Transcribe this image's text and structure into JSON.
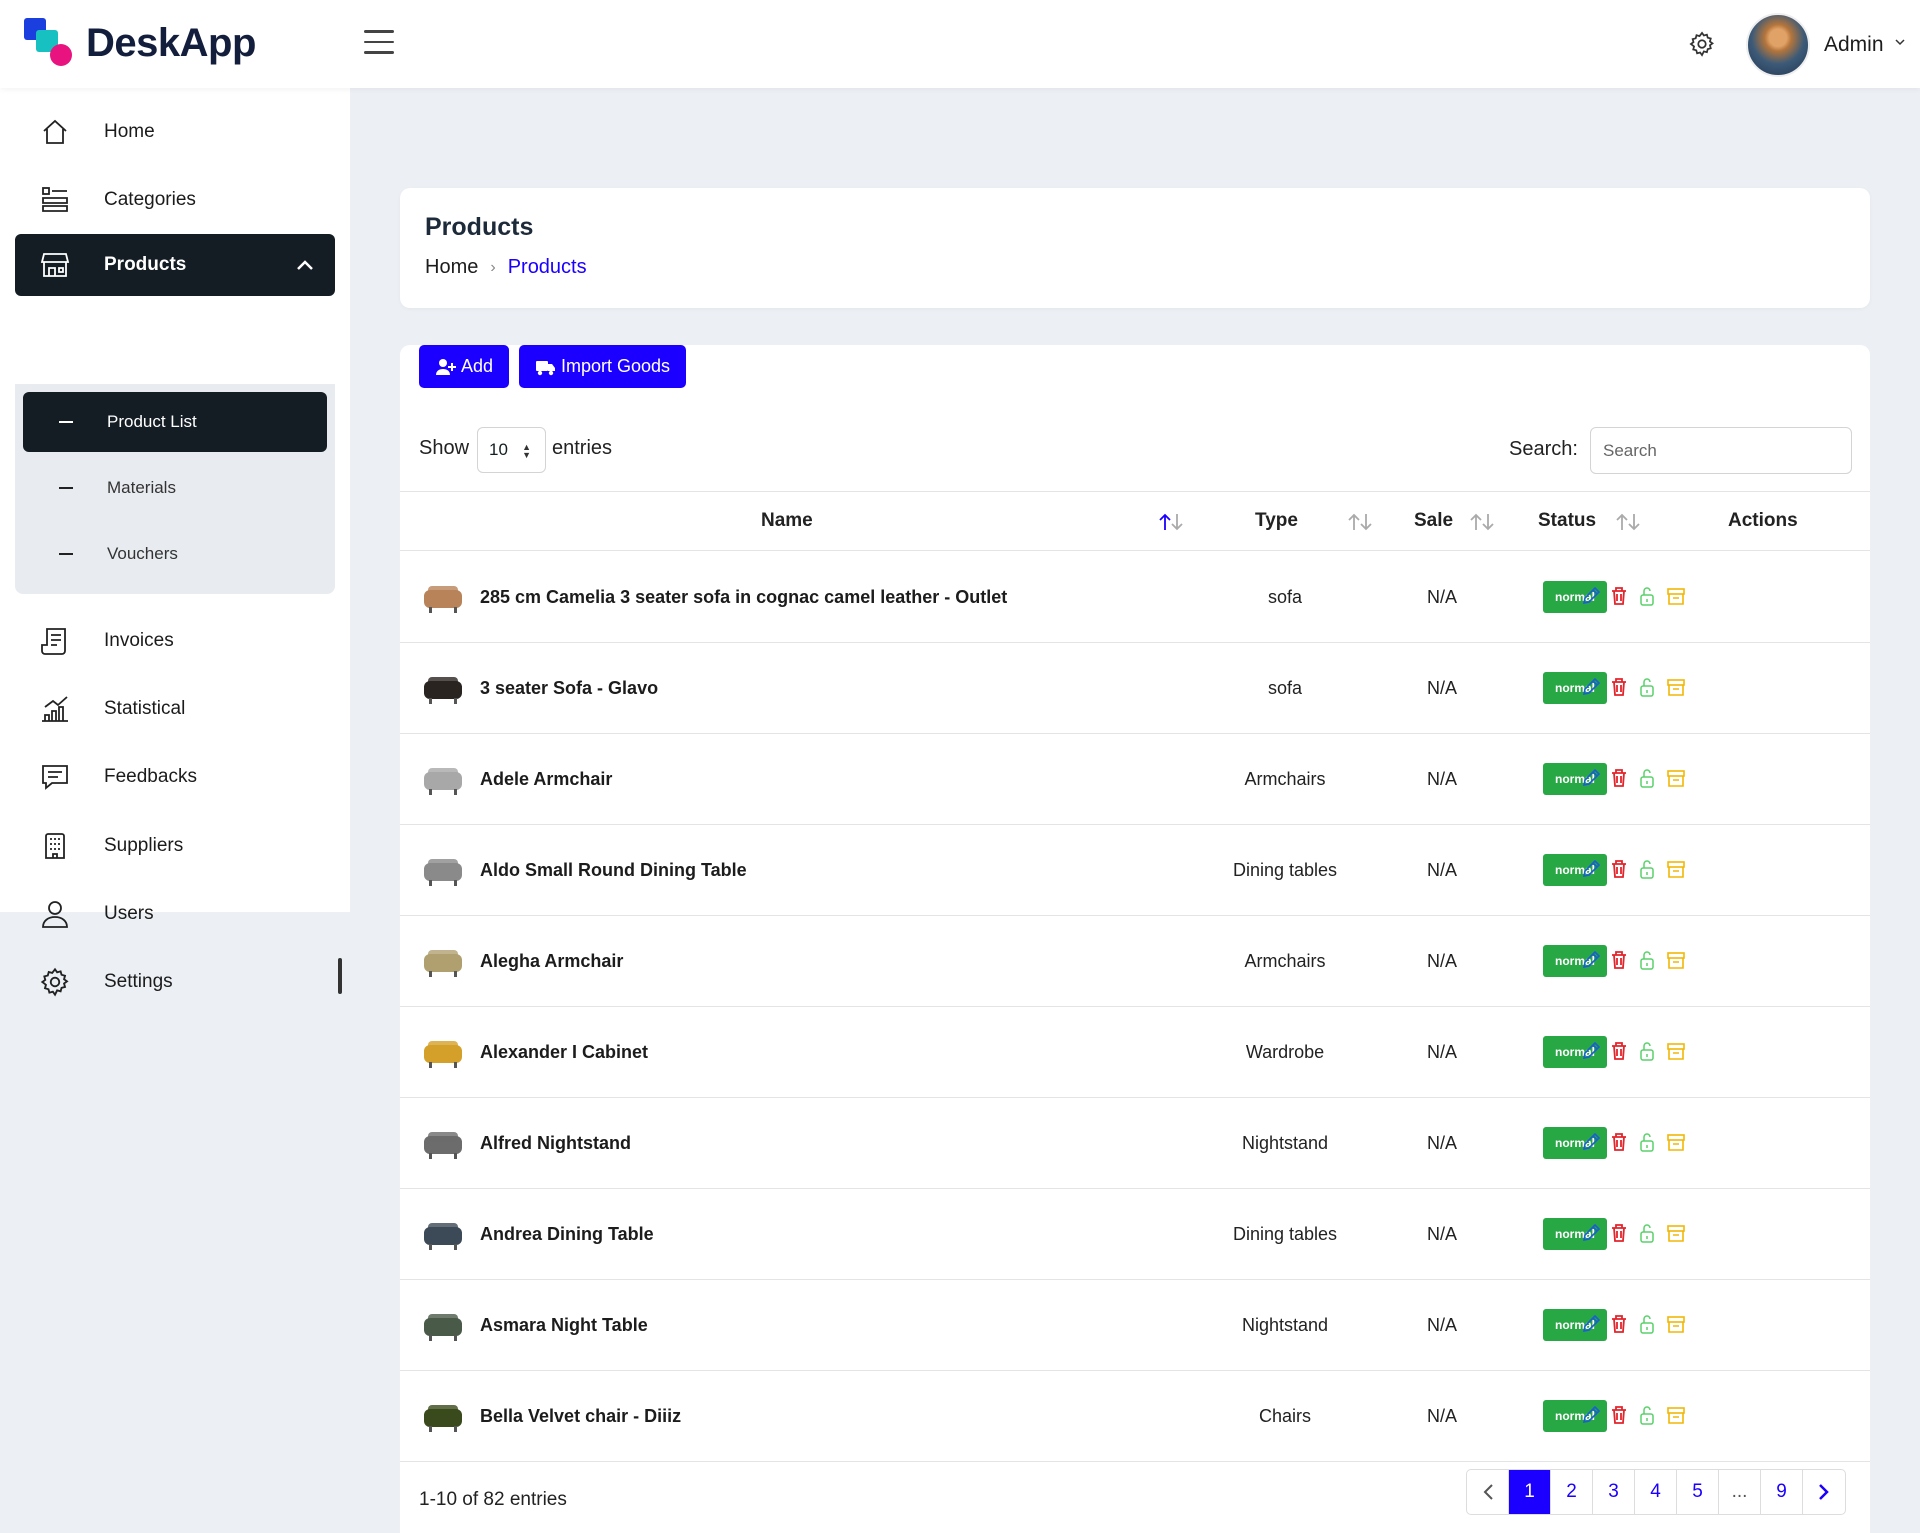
{
  "app": {
    "name": "DeskApp"
  },
  "header": {
    "user_name": "Admin"
  },
  "sidebar": {
    "items": [
      {
        "label": "Home",
        "icon": "home-icon"
      },
      {
        "label": "Categories",
        "icon": "categories-icon"
      },
      {
        "label": "Products",
        "icon": "store-icon"
      },
      {
        "label": "Invoices",
        "icon": "invoice-icon"
      },
      {
        "label": "Statistical",
        "icon": "chart-icon"
      },
      {
        "label": "Feedbacks",
        "icon": "chat-icon"
      },
      {
        "label": "Suppliers",
        "icon": "building-icon"
      },
      {
        "label": "Users",
        "icon": "user-icon"
      },
      {
        "label": "Settings",
        "icon": "gear-icon"
      }
    ],
    "submenu": [
      {
        "label": "Product List"
      },
      {
        "label": "Materials"
      },
      {
        "label": "Vouchers"
      }
    ]
  },
  "page": {
    "title": "Products",
    "breadcrumb": {
      "home": "Home",
      "current": "Products"
    }
  },
  "toolbar": {
    "add_label": "Add",
    "import_label": "Import Goods"
  },
  "table_controls": {
    "show_label": "Show",
    "page_size": "10",
    "entries_label": "entries",
    "search_label": "Search:",
    "search_placeholder": "Search"
  },
  "table": {
    "columns": [
      "Name",
      "Type",
      "Sale",
      "Status",
      "Actions"
    ],
    "rows": [
      {
        "name": "285 cm Camelia 3 seater sofa in cognac camel leather - Outlet",
        "type": "sofa",
        "sale": "N/A",
        "status": "normal"
      },
      {
        "name": "3 seater Sofa - Glavo",
        "type": "sofa",
        "sale": "N/A",
        "status": "normal"
      },
      {
        "name": "Adele Armchair",
        "type": "Armchairs",
        "sale": "N/A",
        "status": "normal"
      },
      {
        "name": "Aldo Small Round Dining Table",
        "type": "Dining tables",
        "sale": "N/A",
        "status": "normal"
      },
      {
        "name": "Alegha Armchair",
        "type": "Armchairs",
        "sale": "N/A",
        "status": "normal"
      },
      {
        "name": "Alexander I Cabinet",
        "type": "Wardrobe",
        "sale": "N/A",
        "status": "normal"
      },
      {
        "name": "Alfred Nightstand",
        "type": "Nightstand",
        "sale": "N/A",
        "status": "normal"
      },
      {
        "name": "Andrea Dining Table",
        "type": "Dining tables",
        "sale": "N/A",
        "status": "normal"
      },
      {
        "name": "Asmara Night Table",
        "type": "Nightstand",
        "sale": "N/A",
        "status": "normal"
      },
      {
        "name": "Bella Velvet chair - Diiiz",
        "type": "Chairs",
        "sale": "N/A",
        "status": "normal"
      }
    ]
  },
  "footer": {
    "info": "1-10 of 82 entries"
  },
  "pagination": {
    "pages": [
      "1",
      "2",
      "3",
      "4",
      "5",
      "...",
      "9"
    ],
    "current": "1"
  },
  "colors": {
    "accent": "#1b00ff",
    "sidebar_active": "#141c24",
    "status_normal": "#28a745",
    "edit": "#1a5fd1",
    "delete": "#e3242b",
    "unlock": "#5ad16a",
    "archive": "#f2b705"
  }
}
